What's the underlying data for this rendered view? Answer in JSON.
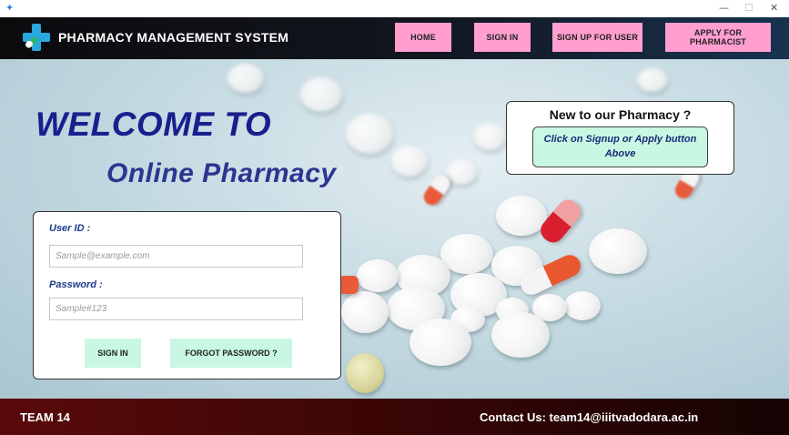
{
  "window": {
    "icon": "feather-icon",
    "min_glyph": "—",
    "max_glyph": "☐",
    "close_glyph": "✕"
  },
  "header": {
    "logo_icon": "medical-cross-pill-icon",
    "title": "PHARMACY MANAGEMENT SYSTEM",
    "nav": {
      "home": "HOME",
      "sign_in": "SIGN IN",
      "sign_up_user": "SIGN UP FOR USER",
      "apply_pharmacist": "APPLY FOR PHARMACIST"
    },
    "nav_color": "#ff9ecf"
  },
  "hero": {
    "welcome": "WELCOME TO",
    "subtitle": "Online Pharmacy"
  },
  "new_panel": {
    "title": "New to our Pharmacy ?",
    "hint_line1": "Click on Signup or Apply button",
    "hint_line2": "Above"
  },
  "login": {
    "user_label": "User ID :",
    "user_placeholder": "Sample@example.com",
    "user_value": "",
    "password_label": "Password :",
    "password_placeholder": "Sample#123",
    "password_value": "",
    "sign_in": "SIGN IN",
    "forgot": "FORGOT PASSWORD ?",
    "button_color": "#c8f7e2"
  },
  "footer": {
    "team": "TEAM 14",
    "contact": "Contact Us: team14@iiitvadodara.ac.in"
  }
}
